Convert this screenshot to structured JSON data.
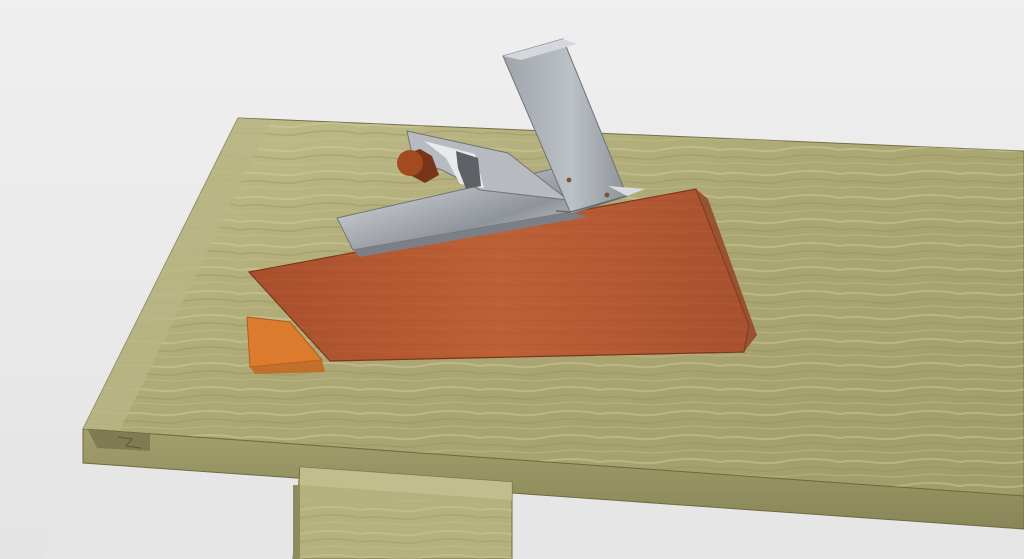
{
  "scene": {
    "name": "3d-workbench-render",
    "objects": [
      "workbench-top",
      "workbench-leg",
      "hand-plane",
      "wooden-shooting-board",
      "orange-stop-block",
      "metal-square"
    ]
  },
  "colors": {
    "floor": "#e5e5e5",
    "bench_top": "#a7a36e",
    "bench_side": "#8c8a5d",
    "bench_grain": "#c8c69a",
    "wood_board": "#b65b34",
    "wood_board_dark": "#8a3d22",
    "metal": "#b9bcc0",
    "metal_dark": "#5f6165",
    "knob": "#8a3a19",
    "stop_block": "#df7b2b"
  }
}
